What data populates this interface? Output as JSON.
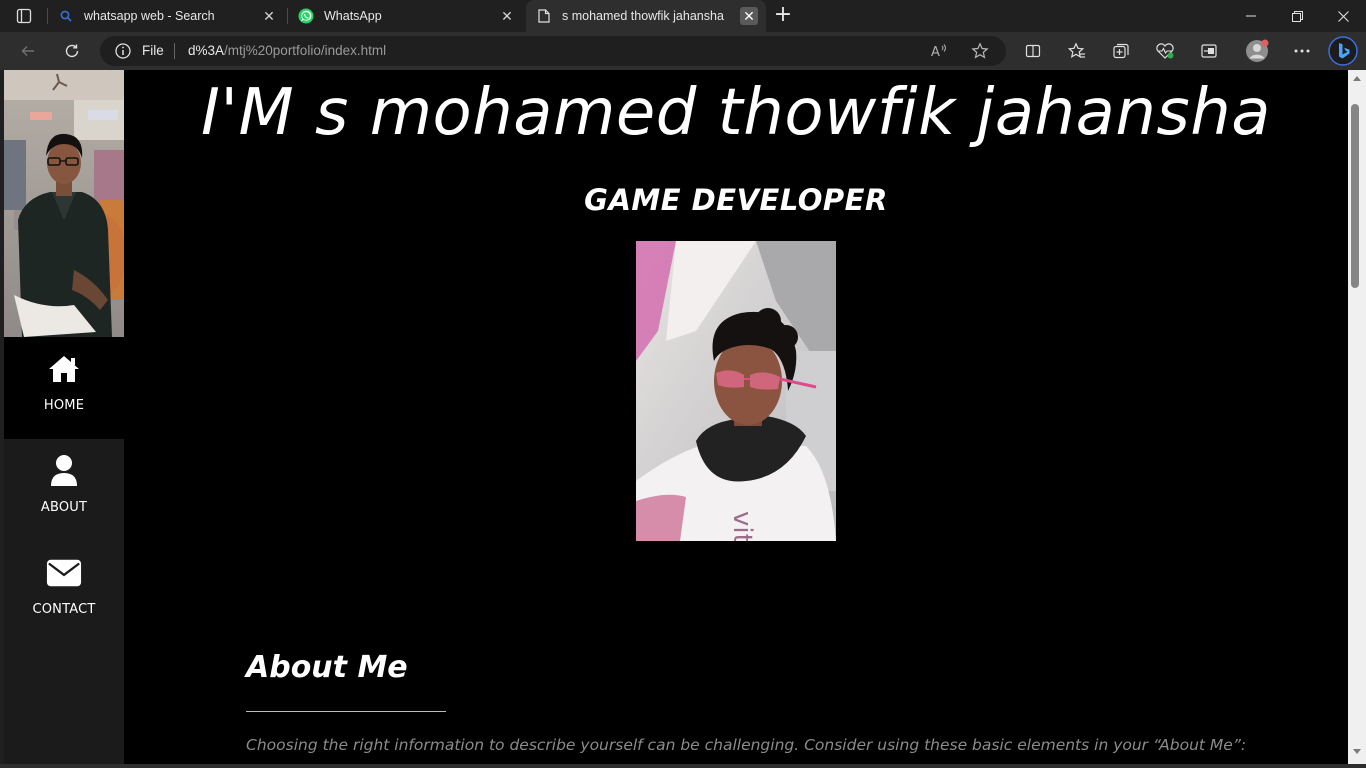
{
  "browser": {
    "tabs": [
      {
        "title": "whatsapp web - Search",
        "favicon": "search-icon",
        "active": false
      },
      {
        "title": "WhatsApp",
        "favicon": "whatsapp-icon",
        "active": false
      },
      {
        "title": "s mohamed thowfik jahansha",
        "favicon": "page-icon",
        "active": true
      }
    ],
    "address": {
      "scheme_label": "File",
      "host": "d%3A",
      "path": "/mtj%20portfolio/index.html"
    }
  },
  "page": {
    "sidebar": {
      "nav": [
        {
          "label": "HOME",
          "icon": "home-icon",
          "active": true
        },
        {
          "label": "ABOUT",
          "icon": "user-icon",
          "active": false
        },
        {
          "label": "CONTACT",
          "icon": "envelope-icon",
          "active": false
        }
      ]
    },
    "hero": {
      "title": "I'M s mohamed thowfik jahansha",
      "subtitle": "GAME DEVELOPER"
    },
    "about": {
      "heading": "About Me",
      "text": "Choosing the right information to describe yourself can be challenging. Consider using these basic elements in your “About Me”:"
    }
  }
}
